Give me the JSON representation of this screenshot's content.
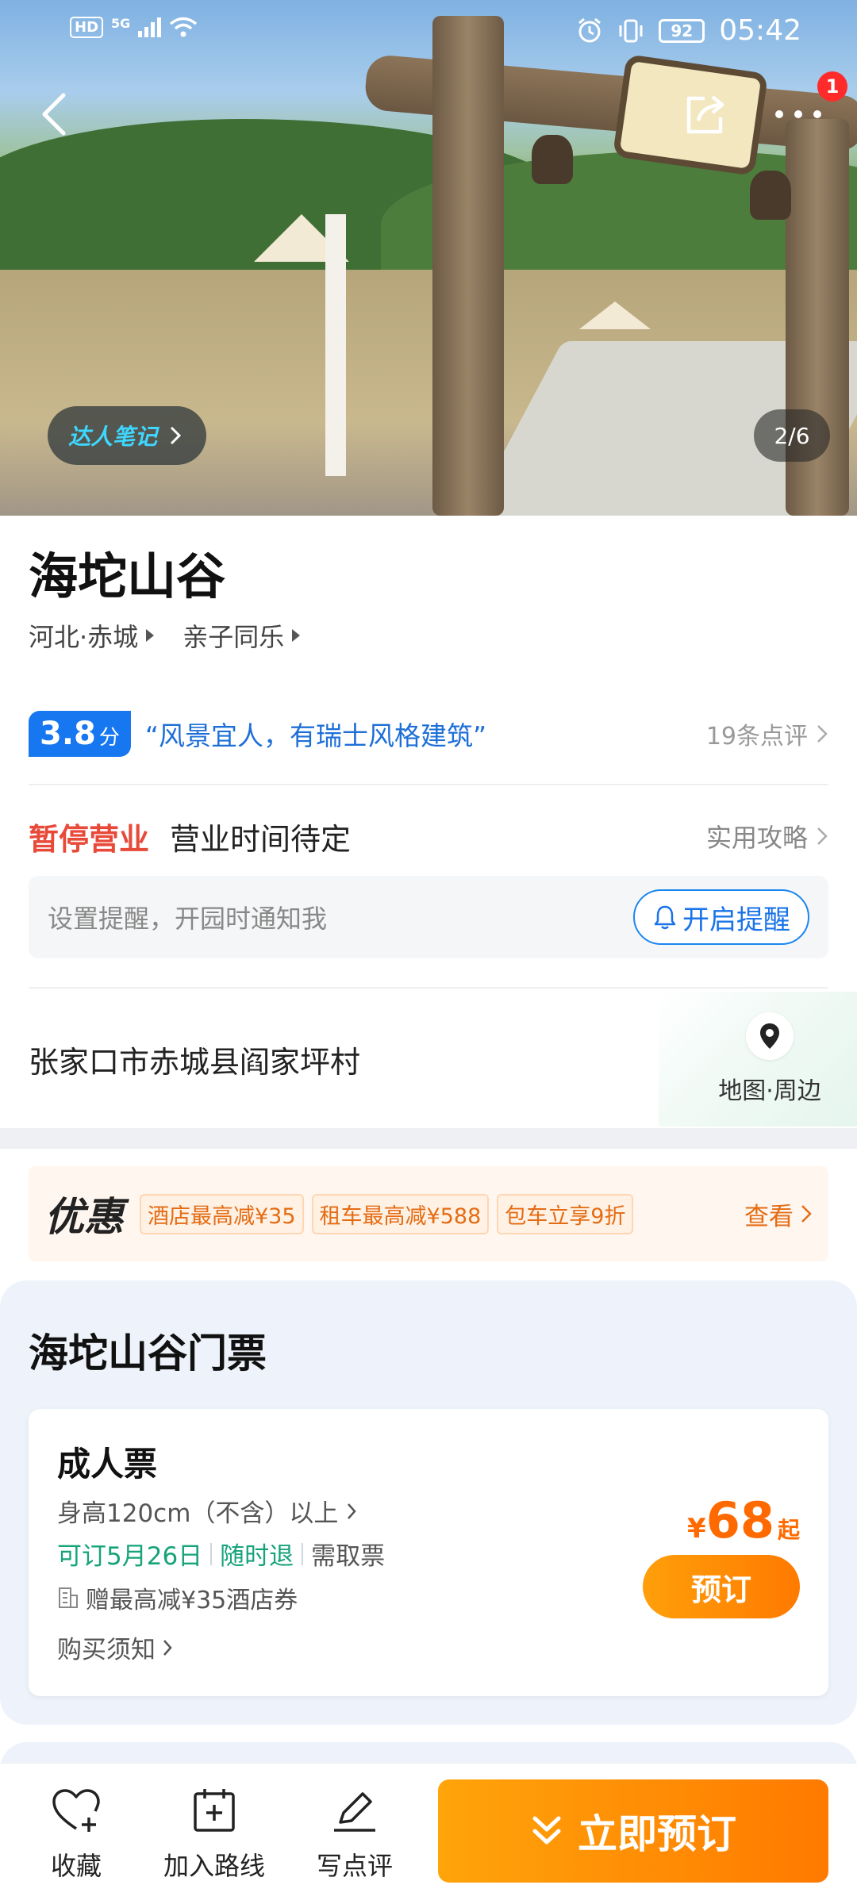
{
  "status_bar": {
    "hd": "HD",
    "network": "5G",
    "battery": "92",
    "time": "05:42"
  },
  "hero": {
    "notes_label": "达人笔记",
    "image_counter": "2/6",
    "notification_count": "1"
  },
  "attraction": {
    "name": "海坨山谷",
    "location": "河北·赤城",
    "category": "亲子同乐"
  },
  "rating": {
    "score": "3.8",
    "unit": "分",
    "quote": "“风景宜人，有瑞士风格建筑”",
    "reviews": "19条点评"
  },
  "status": {
    "closed_label": "暂停营业",
    "hours": "营业时间待定",
    "guide": "实用攻略"
  },
  "reminder": {
    "hint": "设置提醒，开园时通知我",
    "button": "开启提醒"
  },
  "address": {
    "text": "张家口市赤城县阎家坪村",
    "map_label": "地图·周边"
  },
  "promo": {
    "label": "优惠",
    "tags": [
      "酒店最高减¥35",
      "租车最高减¥588",
      "包车立享9折"
    ],
    "view": "查看"
  },
  "tickets": {
    "section_title": "海坨山谷门票",
    "items": [
      {
        "name": "成人票",
        "height_rule": "身高120cm（不含）以上",
        "bookable": "可订5月26日",
        "refund": "随时退",
        "pickup": "需取票",
        "coupon": "赠最高减¥35酒店券",
        "notice": "购买须知",
        "currency": "¥",
        "price": "68",
        "price_suffix": "起",
        "book_label": "预订"
      }
    ]
  },
  "bottom_bar": {
    "favorite": "收藏",
    "add_route": "加入路线",
    "write_review": "写点评",
    "book_now": "立即预订"
  },
  "colors": {
    "brand_blue": "#1677f0",
    "orange": "#ff7a00",
    "closed_red": "#e84a3a",
    "green": "#16a37a"
  }
}
